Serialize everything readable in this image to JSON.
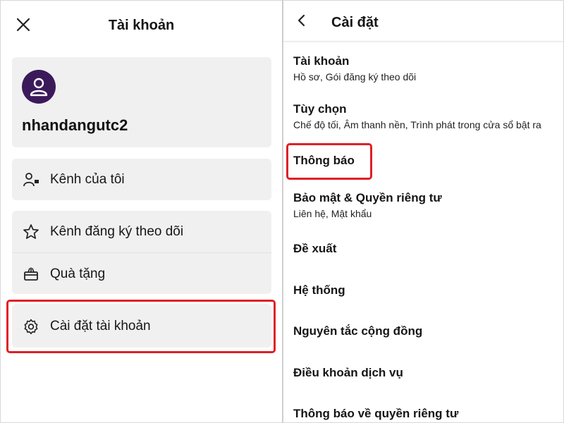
{
  "left": {
    "title": "Tài khoản",
    "username": "nhandangutc2",
    "menu": {
      "my_channel": "Kênh của tôi",
      "subscriptions": "Kênh đăng ký theo dõi",
      "gifts": "Quà tặng",
      "account_settings": "Cài đặt tài khoản"
    }
  },
  "right": {
    "title": "Cài đặt",
    "items": [
      {
        "title": "Tài khoản",
        "subtitle": "Hồ sơ, Gói đăng ký theo dõi"
      },
      {
        "title": "Tùy chọn",
        "subtitle": "Chế độ tối, Âm thanh nền, Trình phát trong cửa sổ bật ra"
      },
      {
        "title": "Thông báo"
      },
      {
        "title": "Bảo mật & Quyền riêng tư",
        "subtitle": "Liên hệ, Mật khẩu"
      },
      {
        "title": "Đề xuất"
      },
      {
        "title": "Hệ thống"
      },
      {
        "title": "Nguyên tắc cộng đồng"
      },
      {
        "title": "Điều khoản dịch vụ"
      },
      {
        "title": "Thông báo về quyền riêng tư"
      }
    ]
  },
  "colors": {
    "highlight": "#e01f26",
    "avatar_bg": "#3b1a5a",
    "card_bg": "#f0f0f0"
  },
  "icons": [
    "close-icon",
    "user-icon",
    "channel-icon",
    "star-icon",
    "gift-icon",
    "gear-icon",
    "back-icon"
  ]
}
